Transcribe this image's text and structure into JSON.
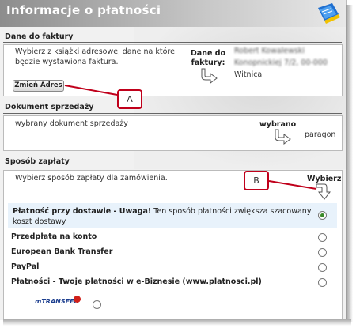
{
  "header": {
    "title": "Informacje o płatności"
  },
  "billing": {
    "section_title": "Dane do faktury",
    "description": "Wybierz z książki adresowej dane na które będzie wystawiona faktura.",
    "change_button": "Zmień Adres",
    "label_line1": "Dane do",
    "label_line2": "faktury:",
    "address_line1": "Robert Kowalewski",
    "address_line2": "Konopnickiej 7/2, 00-000",
    "address_city": "Witnica"
  },
  "sales_document": {
    "section_title": "Dokument sprzedaży",
    "description": "wybrany dokument sprzedaży",
    "label": "wybrano",
    "value": "paragon"
  },
  "payment": {
    "section_title": "Sposób zapłaty",
    "description": "Wybierz sposób zapłaty dla zamówienia.",
    "label": "Wybierz",
    "selected_main": "Płatność przy dostawie - Uwaga!",
    "selected_note": " Ten sposób płatności zwiększa szacowany koszt dostawy.",
    "options": [
      {
        "label": "Przedpłata na konto"
      },
      {
        "label": "European Bank Transfer"
      },
      {
        "label": "PayPal"
      },
      {
        "label": "Płatności - Twoje płatności w e-Biznesie (www.platnosci.pl)"
      }
    ],
    "last_option_logo": "mTRANSFER"
  },
  "callouts": {
    "a": "A",
    "b": "B"
  },
  "colors": {
    "callout_border": "#c0001b",
    "selected_radio": "#3a8a2a",
    "highlight": "#e8f2fb"
  }
}
